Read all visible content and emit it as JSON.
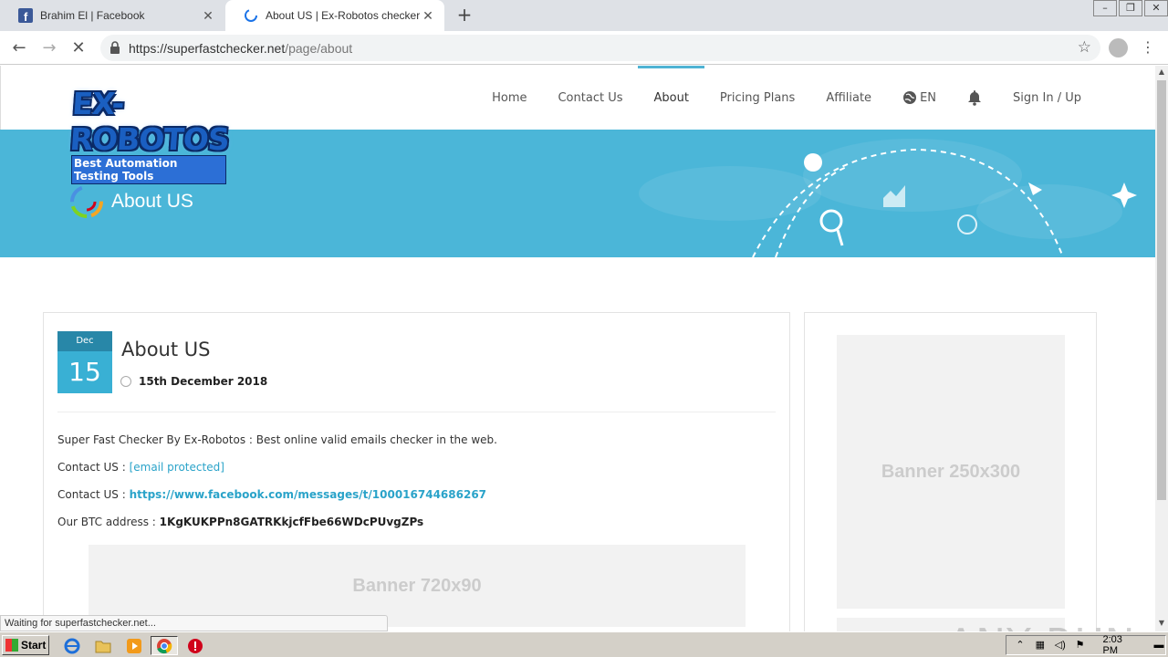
{
  "browser": {
    "tabs": [
      {
        "title": "Brahim El | Facebook",
        "active": false
      },
      {
        "title": "About US | Ex-Robotos checker",
        "active": true
      }
    ],
    "url_host": "https://superfastchecker.net",
    "url_path": "/page/about",
    "status_text": "Waiting for superfastchecker.net..."
  },
  "site": {
    "logo_main": "EX-ROBOTOS",
    "logo_sub": "Best Automation Testing Tools",
    "menu": [
      {
        "label": "Home",
        "active": false
      },
      {
        "label": "Contact Us",
        "active": false
      },
      {
        "label": "About",
        "active": true
      },
      {
        "label": "Pricing Plans",
        "active": false
      },
      {
        "label": "Affiliate",
        "active": false
      },
      {
        "label": "EN",
        "active": false
      },
      {
        "label": "",
        "active": false
      },
      {
        "label": "Sign In / Up",
        "active": false
      }
    ],
    "hero_title": "About US",
    "accent": "#4bb6d8"
  },
  "post": {
    "month": "Dec",
    "day": "15",
    "title": "About US",
    "date": "15th December 2018",
    "line1": "Super Fast Checker By Ex-Robotos : Best online valid emails checker in the web.",
    "line2_label": "Contact US : ",
    "line2_link": "[email protected]",
    "line3_label": "Contact US : ",
    "line3_link": "https://www.facebook.com/messages/t/100016744686267",
    "line4_label": "Our BTC address : ",
    "line4_value": "1KgKUKPPn8GATRKkjcfFbe66WDcPUvgZPs",
    "banner_wide": "Banner  720x90"
  },
  "sidebar": {
    "banner_tall": "Banner  250x300"
  },
  "watermark": "ANY RUN",
  "taskbar": {
    "start": "Start",
    "clock": "2:03 PM"
  }
}
